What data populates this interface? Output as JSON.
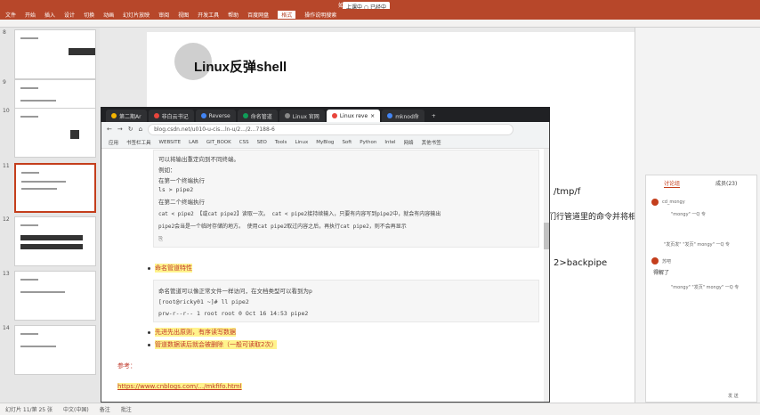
{
  "ppt": {
    "title": "如何I.jt",
    "menu": [
      "文件",
      "开始",
      "插入",
      "设计",
      "切换",
      "动画",
      "幻灯片放映",
      "审阅",
      "视图",
      "开发工具",
      "帮助",
      "百度网盘",
      "格式",
      "操作说明搜索"
    ],
    "active_menu": "格式",
    "chips": [
      "上课中 ○ 已经中"
    ],
    "slide_title": "Linux反弹shell",
    "slide_fragments": [
      "/tmp/f",
      "们行管道里的命令并将相",
      "2>backpipe"
    ],
    "slide_numbers": [
      "8",
      "9",
      "10",
      "11",
      "12",
      "13",
      "14"
    ],
    "status": [
      "幻灯片 11/第 25 张",
      "中文(中国)",
      "备注",
      "批注"
    ]
  },
  "comments": {
    "tabs": [
      "讨论组",
      "成员(23)"
    ],
    "items": [
      {
        "user": "cd_mongy",
        "text": "\"mongy\" 一Q 专"
      },
      {
        "user": "",
        "text": "\"发页发\" \"发页\" mongy\" 一Q 专"
      },
      {
        "user": "苏吧",
        "text": "得解了"
      },
      {
        "user": "",
        "text": "\"mongy\" \"发页\" mongy\" 一Q 专"
      }
    ],
    "send_label": "发 送"
  },
  "browser": {
    "tabs": [
      {
        "label": "第二期Ar",
        "color": "#f4b400"
      },
      {
        "label": "非白云书记",
        "color": "#e8453c"
      },
      {
        "label": "Reverse",
        "color": "#4285f4"
      },
      {
        "label": "命名管道",
        "color": "#0f9d58"
      },
      {
        "label": "Linux 官网",
        "color": "#888888"
      },
      {
        "label": "Linux reve",
        "color": "#e8453c",
        "active": true
      },
      {
        "label": "mknod命",
        "color": "#4285f4"
      }
    ],
    "new_tab": "+",
    "url": "blog.csdn.net/u010-u-cis...ln-u/2.../2...7188-6",
    "bookmarks": [
      "应用",
      "书签栏工具",
      "WEBSITE",
      "LAB",
      "GIT_BOOK",
      "CSS",
      "SEO",
      "Tools",
      "Linux",
      "MyBlog",
      "Soft",
      "Python",
      "Intel",
      "网络",
      "其他书签"
    ]
  },
  "article": {
    "block1": [
      "可以将输出重定向到不同终端。",
      "例如：",
      "在第一个终端执行",
      "ls > pipe2",
      "在第二个终端执行",
      "cat < pipe2 【或cat pipe2】读取一次。 cat < pipe2接持续输入，只要有内容写到pipe2中，就会有内容输出",
      "pipe2会当是一个临时存储的地方。 使用cat pipe2取过内容之后，再执行cat pipe2，则不会再显示"
    ],
    "bullet1": "命名管道特性",
    "block2": [
      "命名管道可以像正常文件一样访问，在文档类型可以看到为p",
      "[root@ricky01 ~]# ll pipe2",
      "prw-r--r-- 1 root root 0 Oct 16 14:53 pipe2"
    ],
    "bullet2": "先进先出原则，有序读写数据",
    "bullet3": "管道数据读后就会被删除（一般可读取2次）",
    "ref_label": "参考：",
    "ref_link": "https://www.cnblogs.com/.../mkfifo.html"
  }
}
